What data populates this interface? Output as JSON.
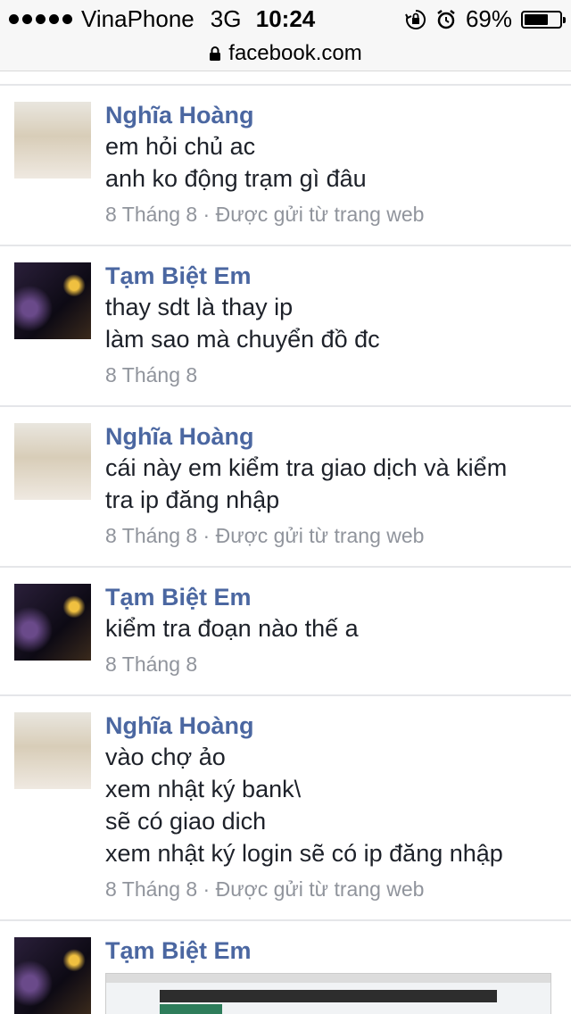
{
  "status_bar": {
    "carrier": "VinaPhone",
    "network": "3G",
    "time": "10:24",
    "battery": "69%",
    "battery_level": 0.69
  },
  "url_bar": {
    "domain": "facebook.com"
  },
  "messages": [
    {
      "author": "Nghĩa Hoàng",
      "lines": [
        "em hỏi chủ ac",
        "anh ko động trạm gì đâu"
      ],
      "meta": "8 Tháng 8 · Được gửi từ trang web"
    },
    {
      "author": "Tạm Biệt Em",
      "lines": [
        "thay sdt là thay ip",
        "làm sao mà chuyển đồ đc"
      ],
      "meta": "8 Tháng 8"
    },
    {
      "author": "Nghĩa Hoàng",
      "lines": [
        "cái này em kiểm tra giao dịch và kiểm",
        "tra ip đăng nhập"
      ],
      "meta": "8 Tháng 8 · Được gửi từ trang web"
    },
    {
      "author": "Tạm Biệt Em",
      "lines": [
        "kiểm tra đoạn nào thế a"
      ],
      "meta": "8 Tháng 8"
    },
    {
      "author": "Nghĩa Hoàng",
      "lines": [
        "vào chợ ảo",
        "xem nhật ký bank\\",
        "sẽ có giao dich",
        "xem nhật ký login sẽ có ip đăng nhập"
      ],
      "meta": "8 Tháng 8 · Được gửi từ trang web"
    },
    {
      "author": "Tạm Biệt Em",
      "lines": [],
      "meta": ""
    }
  ],
  "icons": {
    "lock": "lock-icon",
    "orientation_lock": "orientation-lock-icon",
    "alarm": "alarm-icon",
    "battery": "battery-icon"
  }
}
